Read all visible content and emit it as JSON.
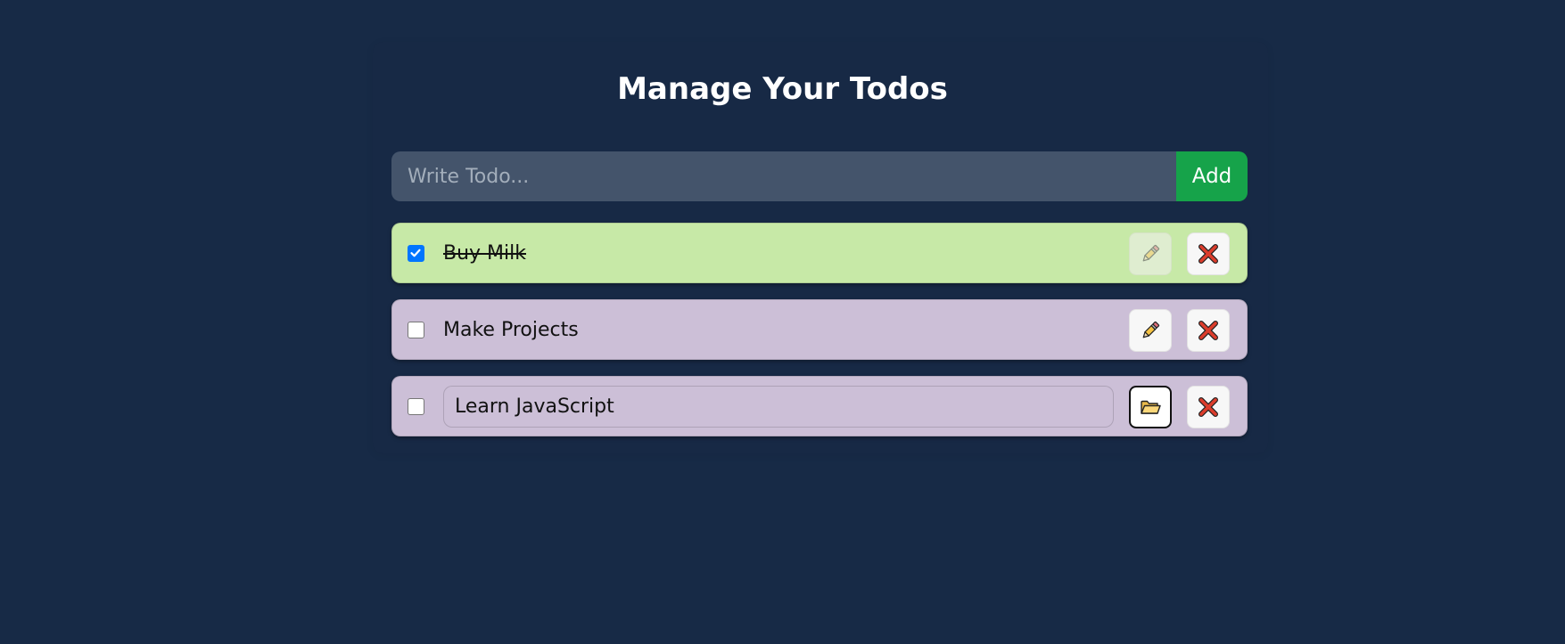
{
  "header": {
    "title": "Manage Your Todos"
  },
  "add_form": {
    "placeholder": "Write Todo...",
    "add_label": "Add"
  },
  "todos": [
    {
      "text": "Buy Milk",
      "completed": true,
      "editing": false,
      "edit_icon": "pencil-icon",
      "delete_icon": "close-icon"
    },
    {
      "text": "Make Projects",
      "completed": false,
      "editing": false,
      "edit_icon": "pencil-icon",
      "delete_icon": "close-icon"
    },
    {
      "text": "Learn JavaScript",
      "completed": false,
      "editing": true,
      "edit_icon": "folder-icon",
      "delete_icon": "close-icon"
    }
  ],
  "colors": {
    "background": "#172a46",
    "add_button": "#16a34a",
    "input_background": "#44546b",
    "completed_row": "#c7e9a7",
    "open_row": "#ccbfd7",
    "checkbox_checked": "#0075ff"
  }
}
